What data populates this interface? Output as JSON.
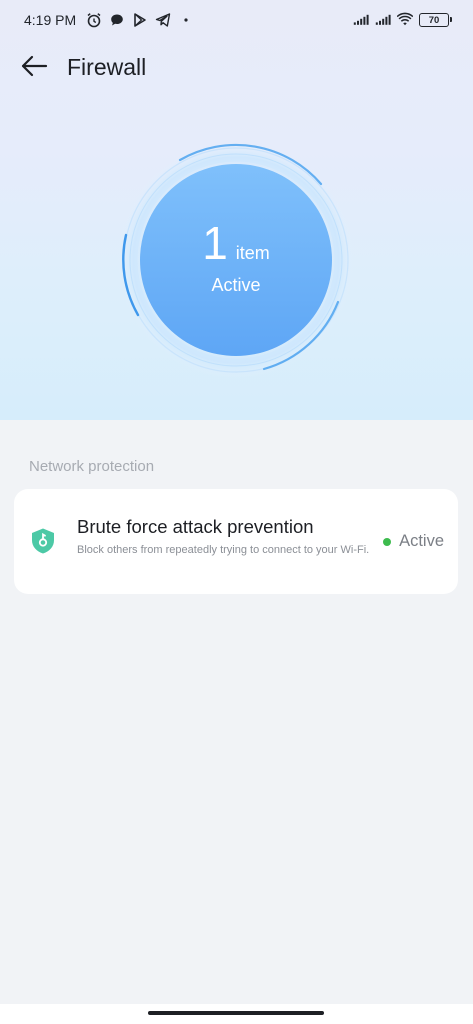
{
  "status_bar": {
    "time": "4:19 PM",
    "left_icons": [
      "alarm-icon",
      "chat-bubble-icon",
      "play-store-icon",
      "telegram-icon",
      "dot-icon"
    ],
    "right_icons": [
      "signal-icon",
      "signal-icon",
      "wifi-icon"
    ],
    "battery": "70"
  },
  "header": {
    "back_icon": "arrow-left-icon",
    "title": "Firewall"
  },
  "summary": {
    "count": "1",
    "unit": "item",
    "status": "Active"
  },
  "section": {
    "label": "Network protection"
  },
  "items": [
    {
      "icon": "shield-key-icon",
      "title": "Brute force attack prevention",
      "description": "Block others from repeatedly trying to connect to your Wi-Fi.",
      "status": "Active",
      "status_color": "#3dbb4e"
    }
  ],
  "colors": {
    "accent_blue": "#5aa8f5",
    "shield_green": "#4cc9a6"
  }
}
